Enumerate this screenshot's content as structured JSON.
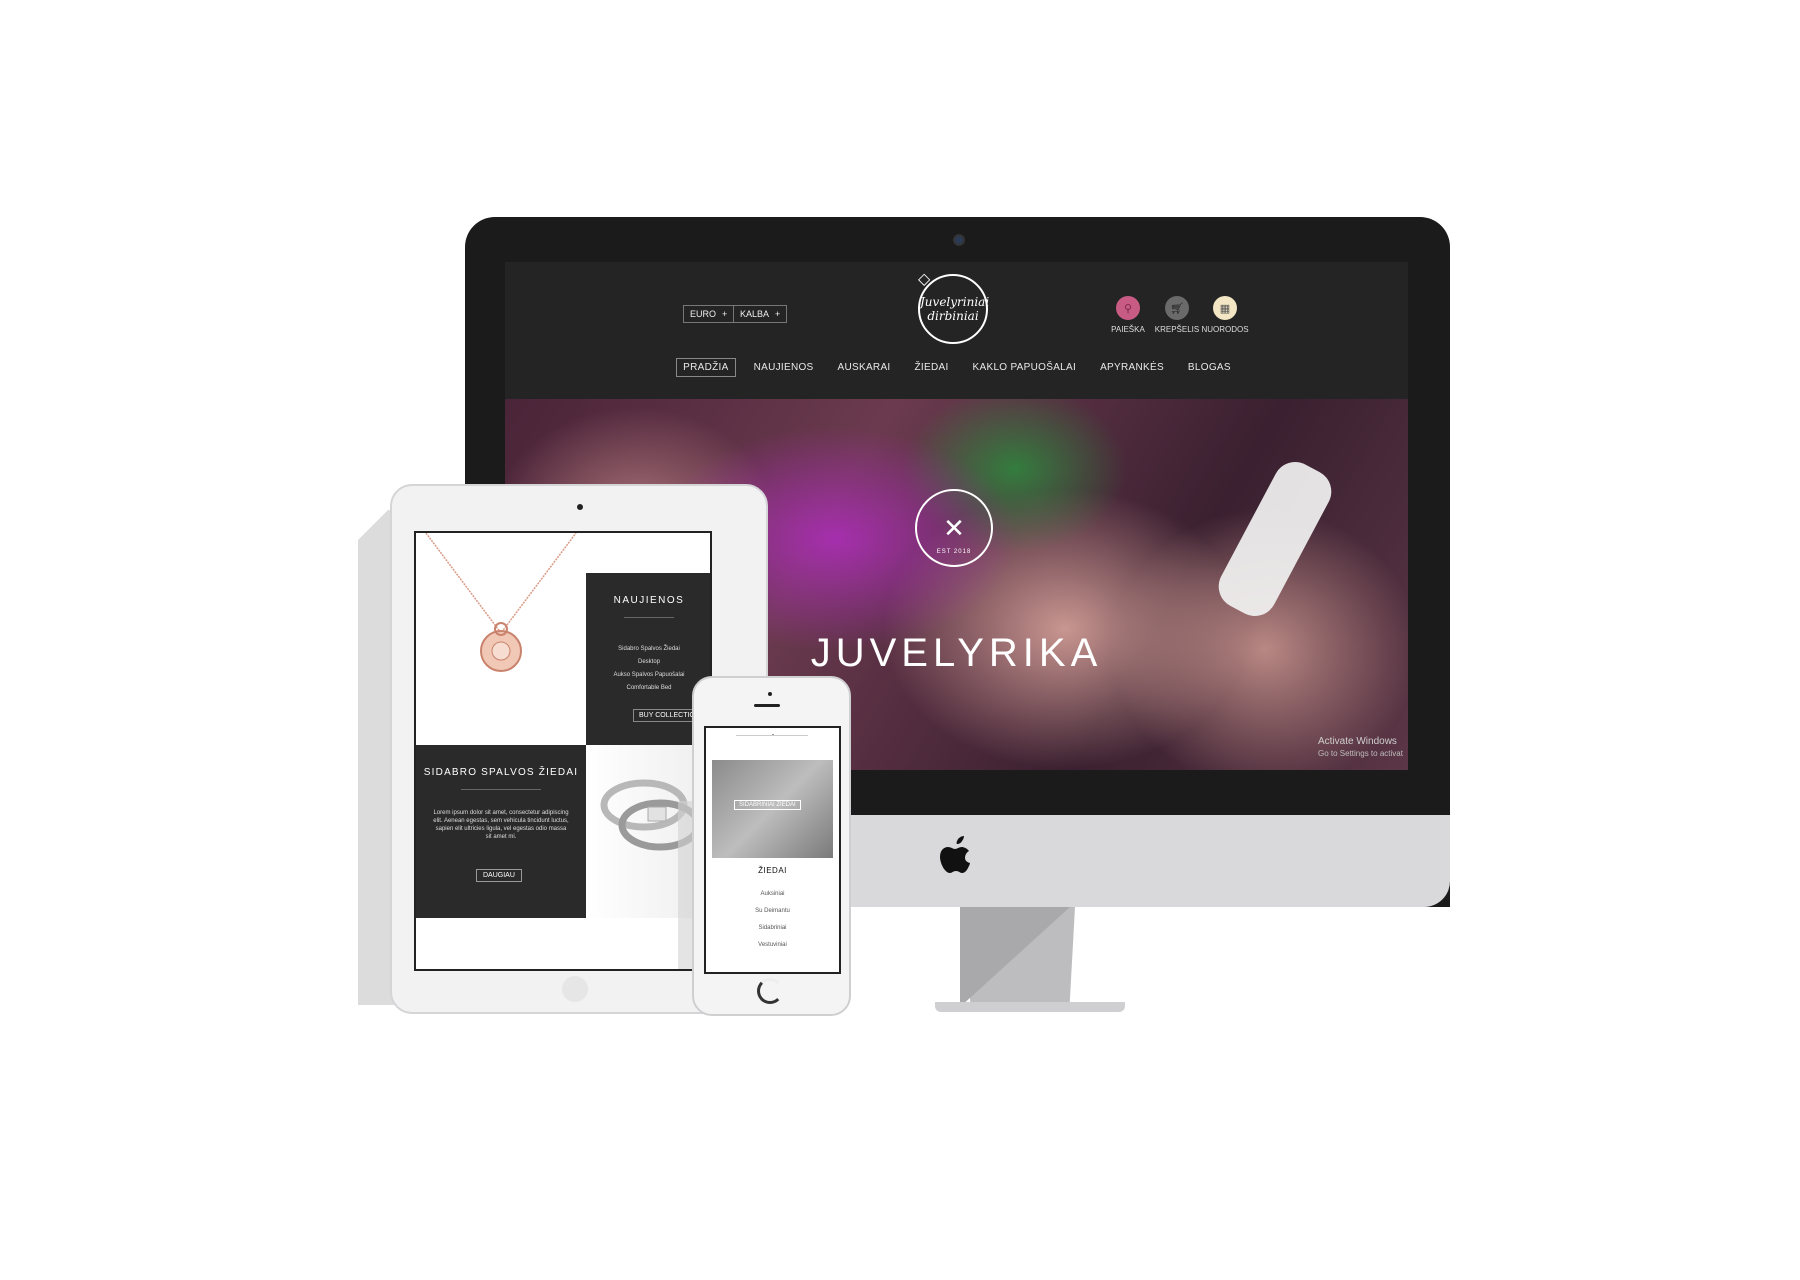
{
  "site": {
    "brand": "Juvelyriniai dirbiniai",
    "brand_line1": "Juvelyriniai",
    "brand_line2": "dirbiniai",
    "currency_label": "EURO",
    "language_label": "KALBA",
    "toolbar_icons": [
      {
        "label": "PAIEŠKA",
        "icon": "search-icon",
        "color": "#c85b83"
      },
      {
        "label": "KREPŠELIS",
        "icon": "cart-icon",
        "color": "#6a6a6a"
      },
      {
        "label": "NUORODOS",
        "icon": "grid-icon",
        "color": "#f3e6c4"
      }
    ],
    "nav": [
      "PRADŽIA",
      "NAUJIENOS",
      "AUSKARAI",
      "ŽIEDAI",
      "KAKLO PAPUOŠALAI",
      "APYRANKĖS",
      "BLOGAS"
    ],
    "active_nav": "PRADŽIA",
    "hero_title": "JUVELYRIKA",
    "hero_emblem_est": "EST 2018",
    "windows_notice_title": "Activate Windows",
    "windows_notice_text": "Go to Settings to activat"
  },
  "tablet": {
    "news_title": "NAUJIENOS",
    "news_items": [
      "Sidabro Spalvos Žiedai",
      "Desktop",
      "Aukso Spalvos Papuošalai",
      "Comfortable Bed"
    ],
    "buy_button": "BUY COLLECTION",
    "silver_title": "SIDABRO SPALVOS ŽIEDAI",
    "silver_text": "Lorem ipsum dolor sit amet, consectetur adipiscing elit. Aenean egestas, sem vehicula tincidunt luctus, sapien elit ultricies ligula, vel egestas odio massa sit amet mi.",
    "more_button": "DAUGIAU"
  },
  "phone": {
    "banner_label": "SIDABRINIAI ŽIEDAI",
    "category_title": "ŽIEDAI",
    "category_items": [
      "Auksiniai",
      "Su Deimantu",
      "Sidabriniai",
      "Vestuviniai"
    ]
  },
  "colors": {
    "dark": "#242424",
    "accent_pink": "#c85b83",
    "rose_gold": "#d89a86"
  }
}
